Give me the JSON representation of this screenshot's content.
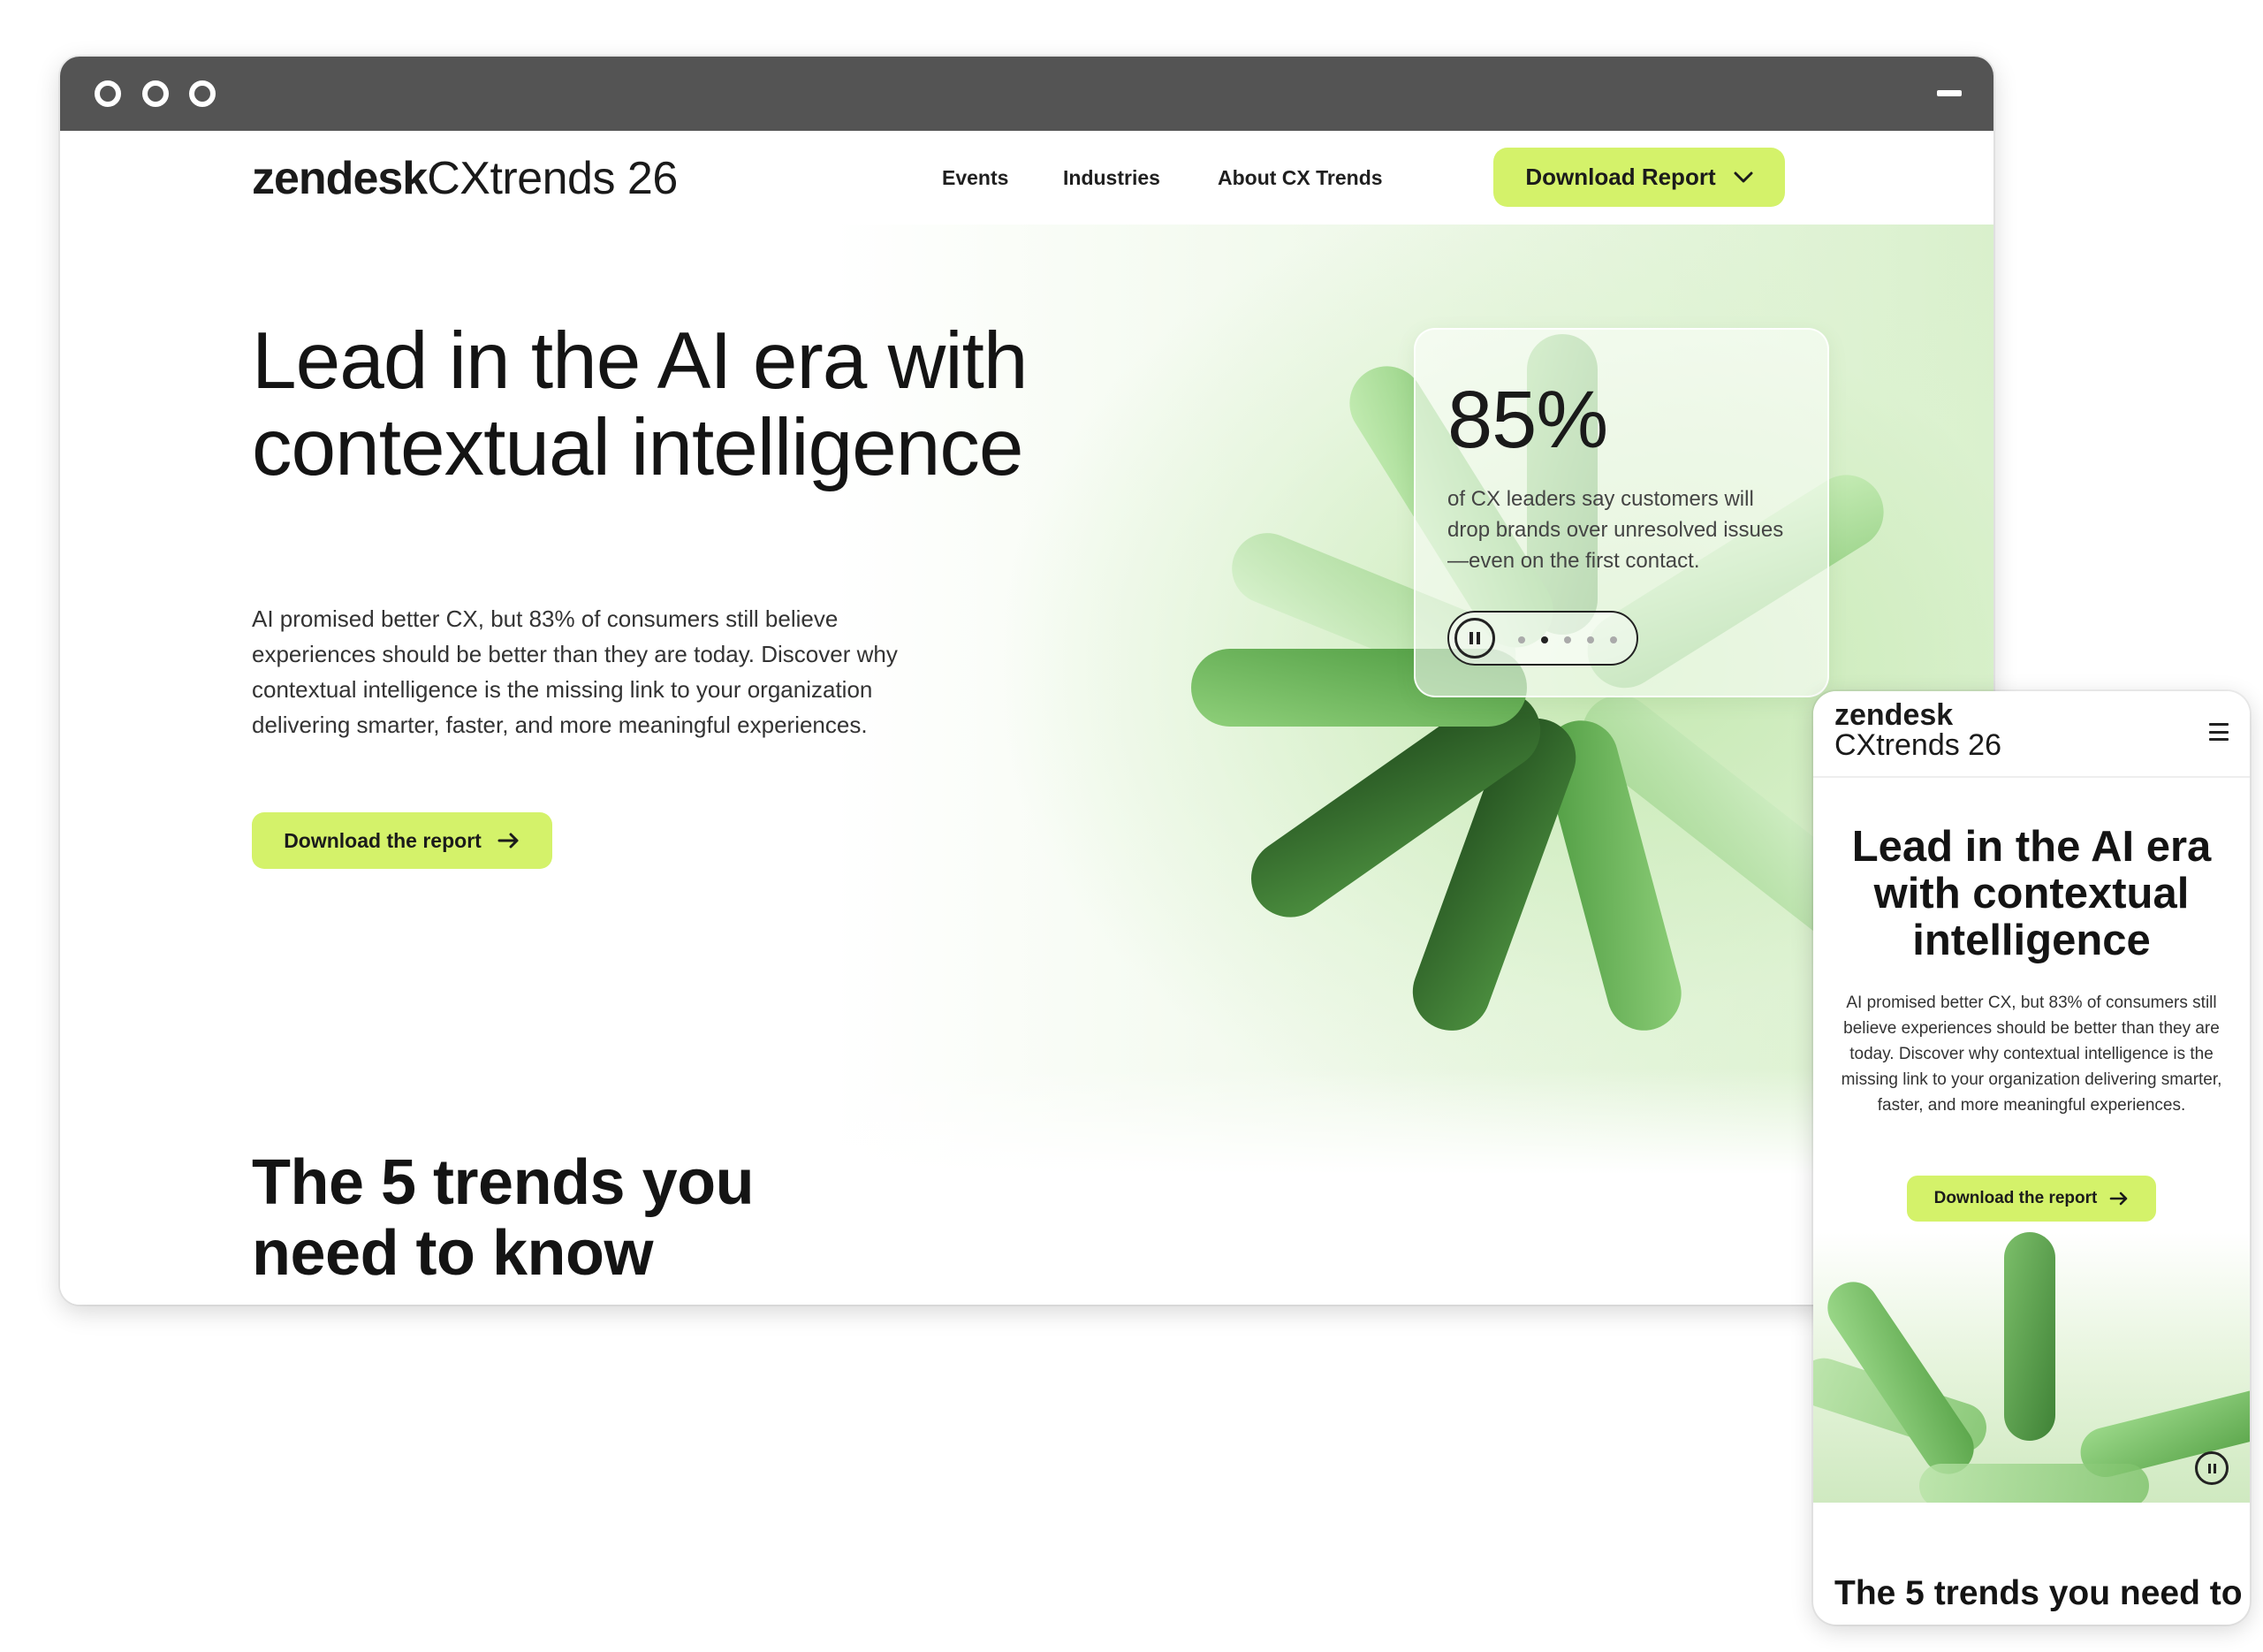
{
  "desktop": {
    "logo": {
      "brand": "zendesk",
      "product": "CXtrends 26"
    },
    "nav": {
      "items": [
        "Events",
        "Industries",
        "About CX Trends"
      ],
      "download_label": "Download Report"
    },
    "hero": {
      "title": "Lead in the AI era with contextual intelligence",
      "body": "AI promised better CX, but 83% of consumers still believe experiences should be better than they are today. Discover why contextual intelligence is the missing link to your organization delivering smarter, faster, and more meaningful experiences.",
      "cta_label": "Download the report"
    },
    "stat": {
      "value": "85%",
      "text": "of CX leaders say customers will drop brands over unresolved issues—even on the first contact.",
      "slides": 5,
      "active_slide": 2
    },
    "trends_title": "The 5 trends you need to know"
  },
  "mobile": {
    "logo": {
      "brand": "zendesk",
      "product": "CXtrends 26"
    },
    "hero": {
      "title": "Lead in the AI era with contextual intelligence",
      "body": "AI promised better CX, but 83% of consumers still believe experiences should be better than they are today. Discover why contextual intelligence is the missing link to your organization delivering smarter, faster, and more meaningful experiences.",
      "cta_label": "Download the report"
    },
    "trends_title": "The 5 trends you need to"
  },
  "colors": {
    "accent": "#d4f26a",
    "titlebar": "#545454",
    "green_dark": "#2f6b2a",
    "green_mid": "#5aa54a",
    "green_light": "#9bd88a"
  },
  "icons": {
    "window_buttons": "circle-icon",
    "dropdown": "chevron-down-icon",
    "arrow": "arrow-right-icon",
    "pause": "pause-icon",
    "menu": "hamburger-menu-icon"
  }
}
